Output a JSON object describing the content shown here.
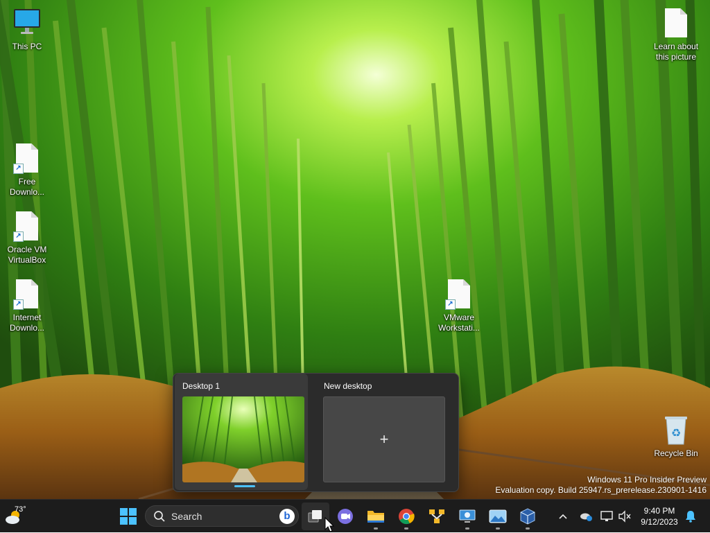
{
  "desktop": {
    "icons": {
      "this_pc": "This PC",
      "learn": "Learn about\nthis picture",
      "free_download": "Free\nDownlo...",
      "virtualbox": "Oracle VM\nVirtualBox",
      "internet_download": "Internet\nDownlo...",
      "vmware": "VMware\nWorkstati...",
      "recycle_bin": "Recycle Bin"
    }
  },
  "task_view": {
    "desktops": [
      {
        "label": "Desktop 1",
        "active": true
      },
      {
        "label": "New desktop",
        "icon": "plus-icon"
      }
    ]
  },
  "watermark": {
    "line1": "Windows 11 Pro Insider Preview",
    "line2": "Evaluation copy. Build 25947.rs_prerelease.230901-1416"
  },
  "taskbar": {
    "weather": {
      "temp": "73°",
      "icon": "weather-partly-sunny-icon"
    },
    "search": {
      "placeholder": "Search"
    },
    "apps": [
      "start-icon",
      "task-view-icon",
      "teams-chat-icon",
      "file-explorer-icon",
      "chrome-icon",
      "network-tool-icon",
      "remote-desktop-icon",
      "photos-icon",
      "virtualbox-icon"
    ],
    "clock": {
      "time": "9:40 PM",
      "date": "9/12/2023"
    },
    "colors": {
      "accent": "#4cc2ff",
      "taskbar": "#1c1c1c"
    }
  }
}
